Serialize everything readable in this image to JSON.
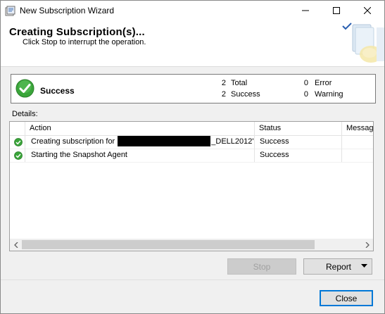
{
  "window": {
    "title": "New Subscription Wizard",
    "icons": [
      "app-icon",
      "minimize-icon",
      "maximize-icon",
      "close-icon"
    ]
  },
  "header": {
    "title": "Creating Subscription(s)...",
    "subtitle": "Click Stop to interrupt the operation.",
    "graphic": "wizard-banner-graphic"
  },
  "summary": {
    "status": "Success",
    "status_icon": "success-check-icon",
    "total_count": "2",
    "total_label": "Total",
    "success_count": "2",
    "success_label": "Success",
    "error_count": "0",
    "error_label": "Error",
    "warning_count": "0",
    "warning_label": "Warning"
  },
  "details": {
    "label": "Details:",
    "columns": [
      "Action",
      "Status",
      "Message"
    ],
    "rows": [
      {
        "action_prefix": "Creating subscription for ",
        "action_suffix": "_DELL2012'",
        "redacted": true,
        "status": "Success",
        "message": ""
      },
      {
        "action_prefix": "Starting the Snapshot Agent",
        "action_suffix": "",
        "redacted": false,
        "status": "Success",
        "message": ""
      }
    ]
  },
  "buttons": {
    "stop": "Stop",
    "report": "Report",
    "close": "Close"
  },
  "colors": {
    "success_green": "#3aa53a",
    "focus_blue": "#0078d7"
  }
}
